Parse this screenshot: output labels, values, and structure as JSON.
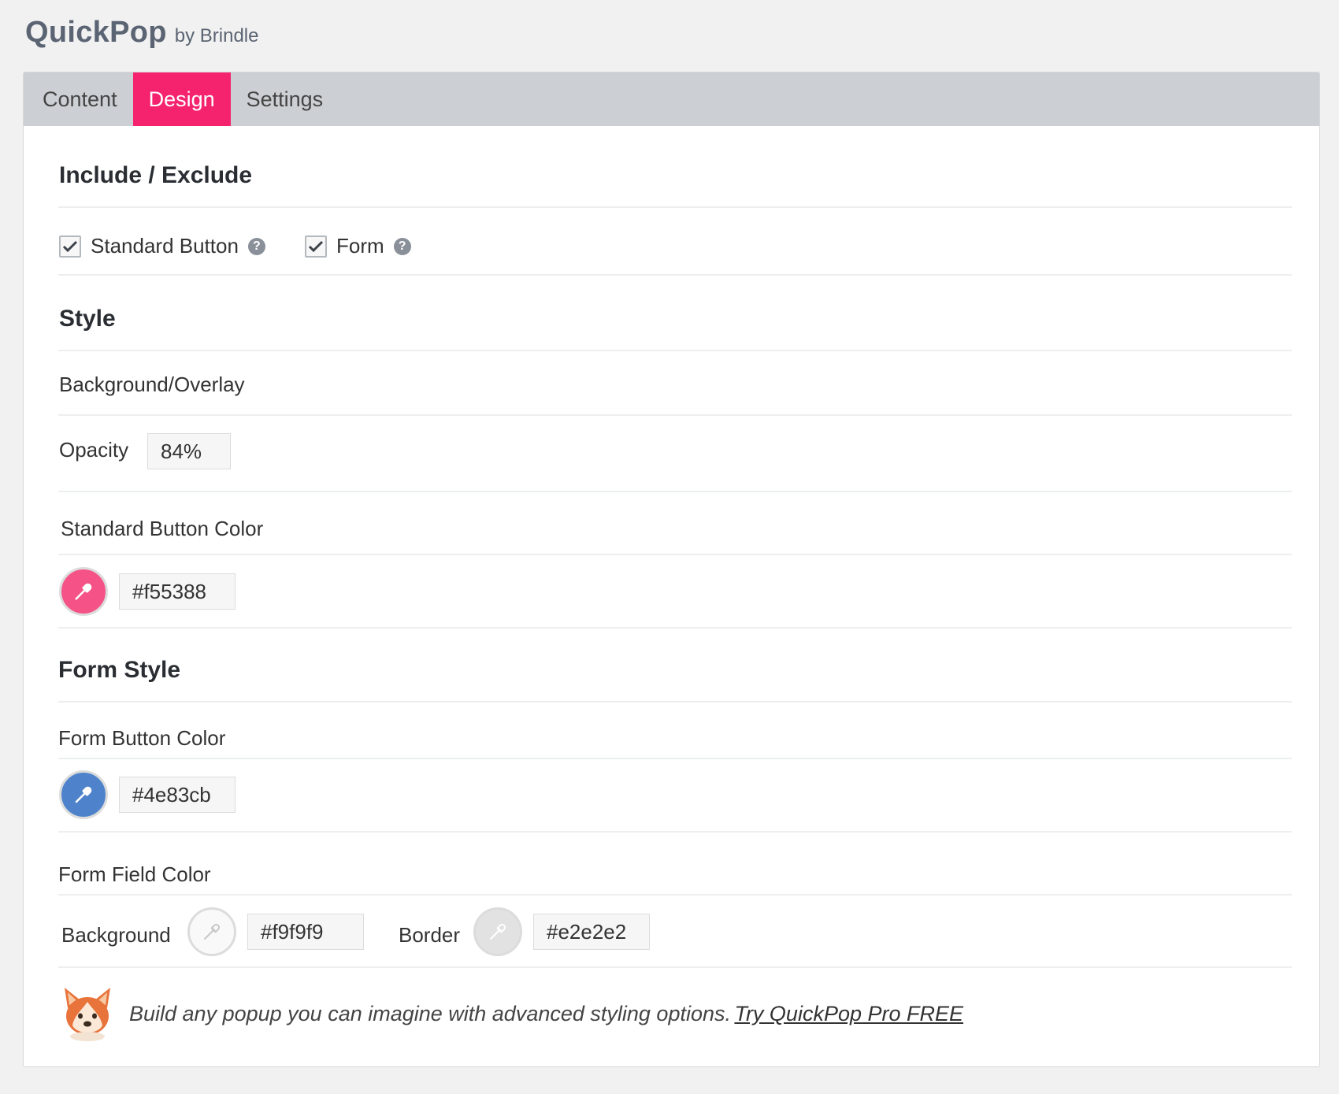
{
  "header": {
    "app_name": "QuickPop",
    "by_text": "by Brindle"
  },
  "tabs": [
    {
      "label": "Content",
      "active": false
    },
    {
      "label": "Design",
      "active": true
    },
    {
      "label": "Settings",
      "active": false
    }
  ],
  "include_exclude": {
    "title": "Include / Exclude",
    "options": [
      {
        "label": "Standard Button",
        "checked": true,
        "help": "?"
      },
      {
        "label": "Form",
        "checked": true,
        "help": "?"
      }
    ]
  },
  "style": {
    "title": "Style",
    "background_overlay_label": "Background/Overlay",
    "opacity_label": "Opacity",
    "opacity_value": "84%",
    "standard_button_color_label": "Standard Button Color",
    "standard_button_color_value": "#f55388"
  },
  "form_style": {
    "title": "Form Style",
    "form_button_color_label": "Form Button Color",
    "form_button_color_value": "#4e83cb",
    "form_field_color_label": "Form Field Color",
    "background_label": "Background",
    "background_value": "#f9f9f9",
    "border_label": "Border",
    "border_value": "#e2e2e2"
  },
  "promo": {
    "text": "Build any popup you can imagine with advanced styling options.",
    "link": "Try QuickPop Pro FREE"
  },
  "colors": {
    "accent_tab": "#f5236e",
    "standard_button": "#f55388",
    "form_button": "#4e83cb",
    "field_background": "#f9f9f9",
    "field_border": "#e2e2e2"
  }
}
